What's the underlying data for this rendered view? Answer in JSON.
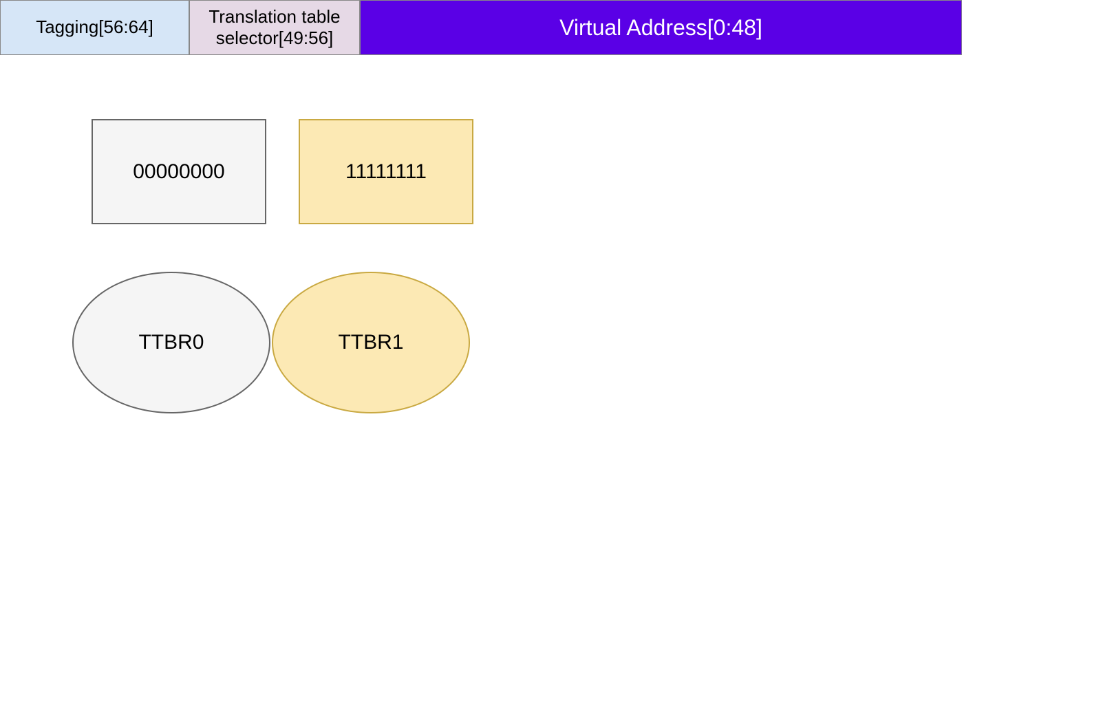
{
  "address_bar": {
    "tagging": "Tagging[56:64]",
    "selector": "Translation table selector[49:56]",
    "virtual": "Virtual Address[0:48]"
  },
  "selector_values": {
    "zeros": "00000000",
    "ones": "11111111"
  },
  "registers": {
    "ttbr0": "TTBR0",
    "ttbr1": "TTBR1"
  },
  "colors": {
    "tagging_bg": "#d6e6f7",
    "selector_bg": "#e6d9e6",
    "virtual_bg": "#5a00e6",
    "neutral_fill": "#f5f5f5",
    "highlight_fill": "#fce9b4",
    "highlight_border": "#c9a942"
  }
}
